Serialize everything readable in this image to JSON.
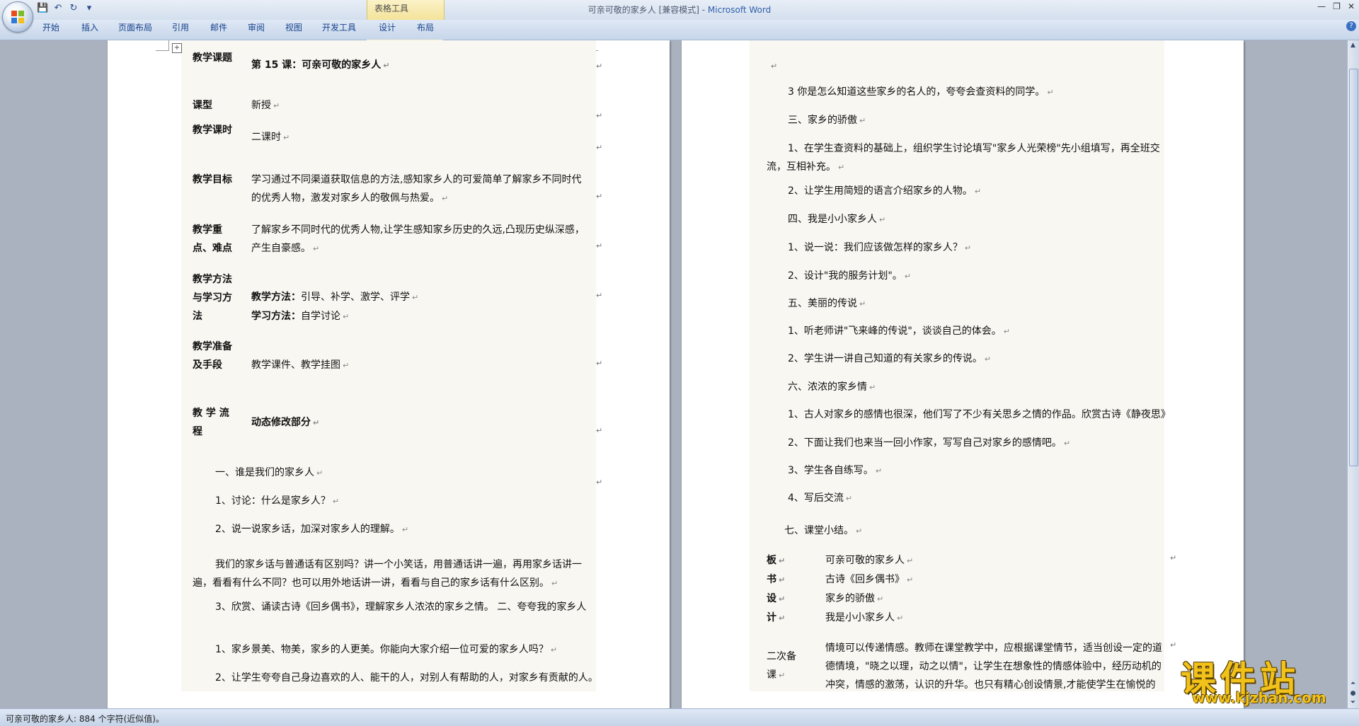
{
  "window": {
    "title_doc": "可亲可敬的家乡人 [兼容模式] - ",
    "title_app": "Microsoft Word",
    "contextual_group": "表格工具"
  },
  "ribbon": {
    "tabs": [
      "开始",
      "插入",
      "页面布局",
      "引用",
      "邮件",
      "审阅",
      "视图",
      "开发工具",
      "设计",
      "布局"
    ]
  },
  "left_page": {
    "rows": [
      {
        "label": "教学课题",
        "value": "第 15 课：可亲可敬的家乡人"
      },
      {
        "label": "课型",
        "value": "新授"
      },
      {
        "label": "教学课时",
        "value": "二课时"
      },
      {
        "label": "教学目标",
        "value": "学习通过不同渠道获取信息的方法,感知家乡人的可爱简单了解家乡不同时代的优秀人物，激发对家乡人的敬佩与热爱。"
      },
      {
        "label": "教学重点、难点",
        "value": "了解家乡不同时代的优秀人物,让学生感知家乡历史的久远,凸现历史纵深感，产生自豪感。"
      },
      {
        "label": "教学方法与学习方法",
        "value_bold_1": "教学方法：",
        "value_1": "引导、补学、激学、评学",
        "value_bold_2": "学习方法：",
        "value_2": "自学讨论"
      },
      {
        "label": "教学准备及手段",
        "value": "教学课件、教学挂图"
      },
      {
        "label": "教 学 流 程",
        "value": "动态修改部分"
      }
    ],
    "body": [
      "一、谁是我们的家乡人",
      "1、讨论：什么是家乡人？",
      "2、说一说家乡话，加深对家乡人的理解。",
      "我们的家乡话与普通话有区别吗？讲一个小笑话，用普通话讲一遍，再用家乡话讲一遍，看看有什么不同？也可以用外地话讲一讲，看看与自己的家乡话有什么区别。",
      "3、欣赏、诵读古诗《回乡偶书》，理解家乡人浓浓的家乡之情。 二、夸夸我的家乡人",
      "1、家乡景美、物美，家乡的人更美。你能向大家介绍一位可爱的家乡人吗？",
      "2、让学生夸夸自己身边喜欢的人、能干的人，对别人有帮助的人，对家乡有贡献的人。"
    ]
  },
  "right_page": {
    "body": [
      "3 你是怎么知道这些家乡的名人的，夸夸会查资料的同学。",
      "三、家乡的骄傲",
      "1、在学生查资料的基础上，组织学生讨论填写\"家乡人光荣榜\"先小组填写，再全班交流，互相补充。",
      "2、让学生用简短的语言介绍家乡的人物。",
      "四、我是小小家乡人",
      "1、说一说：我们应该做怎样的家乡人？",
      "2、设计\"我的服务计划\"。",
      "五、美丽的传说",
      "1、听老师讲\"飞来峰的传说\"，谈谈自己的体会。",
      "2、学生讲一讲自己知道的有关家乡的传说。",
      "六、浓浓的家乡情",
      "1、古人对家乡的感情也很深，他们写了不少有关思乡之情的作品。欣赏古诗《静夜思》",
      "2、下面让我们也来当一回小作家，写写自己对家乡的感情吧。",
      "3、学生各自练写。",
      "4、写后交流",
      "七、课堂小结。"
    ],
    "board_label": [
      "板",
      "书",
      "设",
      "计"
    ],
    "board_items": [
      "可亲可敬的家乡人",
      "古诗《回乡偶书》",
      "家乡的骄傲",
      "我是小小家乡人"
    ],
    "second_label": "二次备课",
    "second_text": "情境可以传递情感。教师在课堂教学中，应根据课堂情节，适当创设一定的道德情境，\"晓之以理，动之以情\"，让学生在想象性的情感体验中，经历动机的冲突，情感的激荡，认识的升华。也只有精心创设情景,才能使学生在愉悦的"
  },
  "status": {
    "text": "可亲可敬的家乡人: 884 个字符(近似值)。"
  },
  "watermark": {
    "title": "课件站",
    "url": "www.kjzhan.com"
  }
}
